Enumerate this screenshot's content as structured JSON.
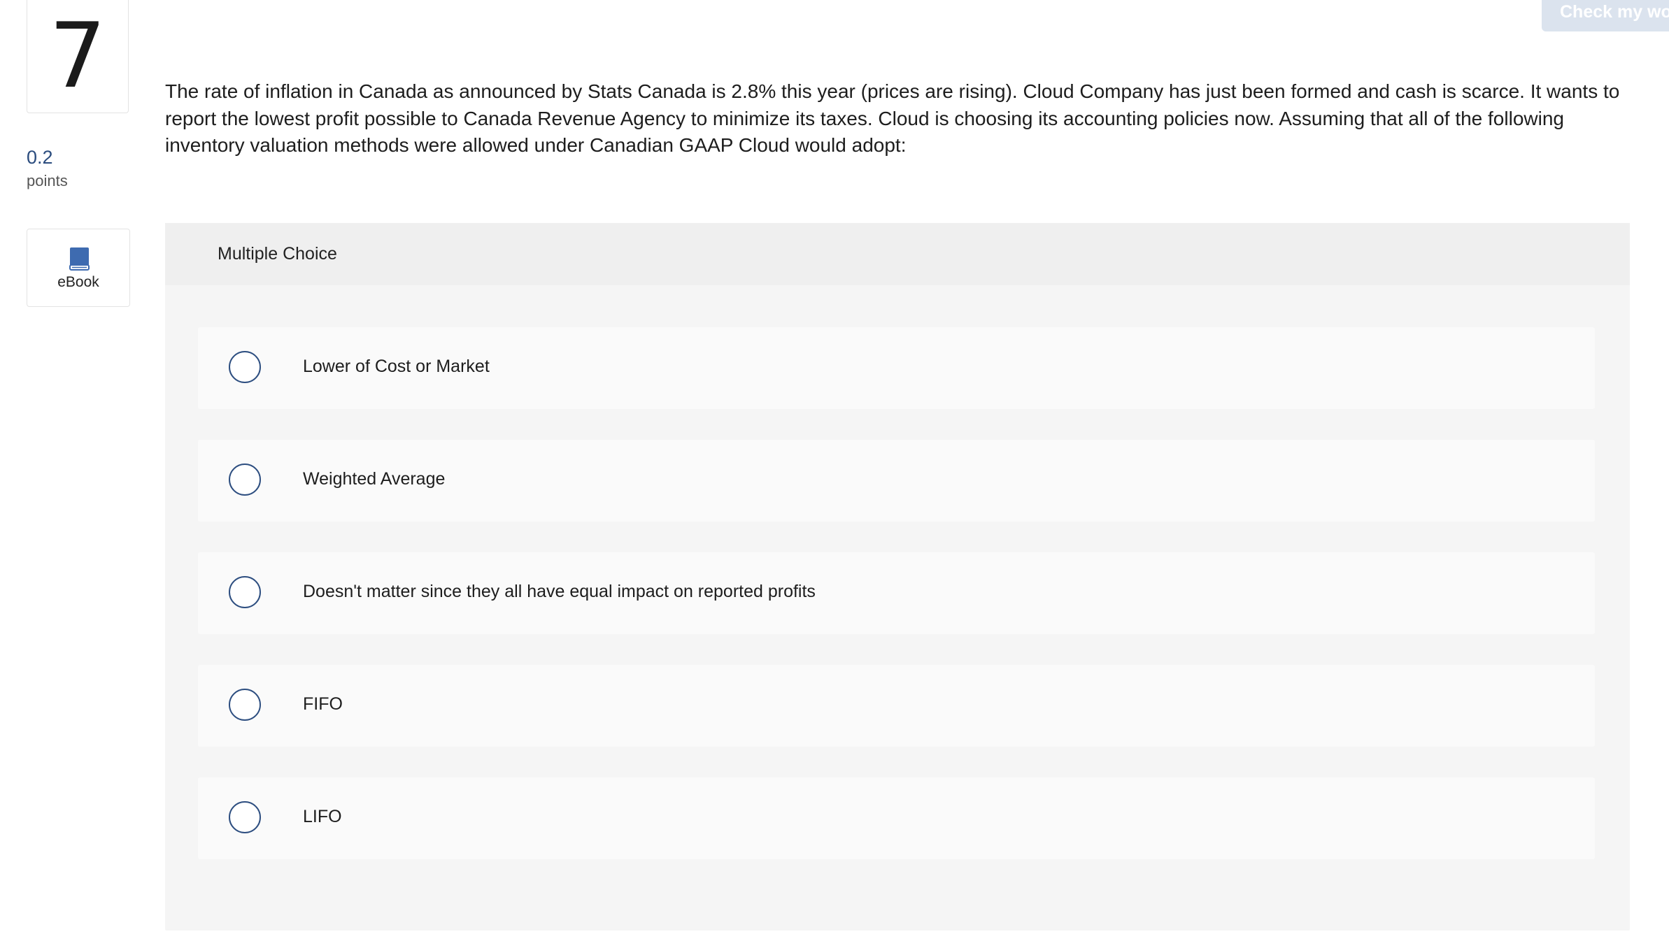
{
  "question": {
    "number": "7",
    "points_value": "0.2",
    "points_label": "points",
    "text": "The rate of inflation in Canada as announced by Stats Canada is 2.8% this year (prices are rising). Cloud Company has just been formed and cash is scarce. It wants to report the lowest profit possible to Canada Revenue Agency to minimize its taxes. Cloud is choosing its accounting policies now. Assuming that all of the following inventory valuation methods were allowed under Canadian GAAP Cloud would adopt:"
  },
  "sidebar": {
    "ebook_label": "eBook",
    "ebook_icon": "book-icon"
  },
  "toolbar": {
    "check_label": "Check my wo"
  },
  "multiple_choice": {
    "header": "Multiple Choice",
    "options": [
      {
        "label": "Lower of Cost or Market",
        "selected": false
      },
      {
        "label": "Weighted Average",
        "selected": false
      },
      {
        "label": "Doesn't matter since they all have equal impact on reported profits",
        "selected": false
      },
      {
        "label": "FIFO",
        "selected": false
      },
      {
        "label": "LIFO",
        "selected": false
      }
    ]
  },
  "colors": {
    "accent": "#2d4e80",
    "points": "#2b4c7e",
    "ebook_icon": "#3e6bb0",
    "check_button_bg": "#dbe3ee",
    "panel_bg": "#f5f5f5",
    "option_bg": "#fafafa"
  }
}
